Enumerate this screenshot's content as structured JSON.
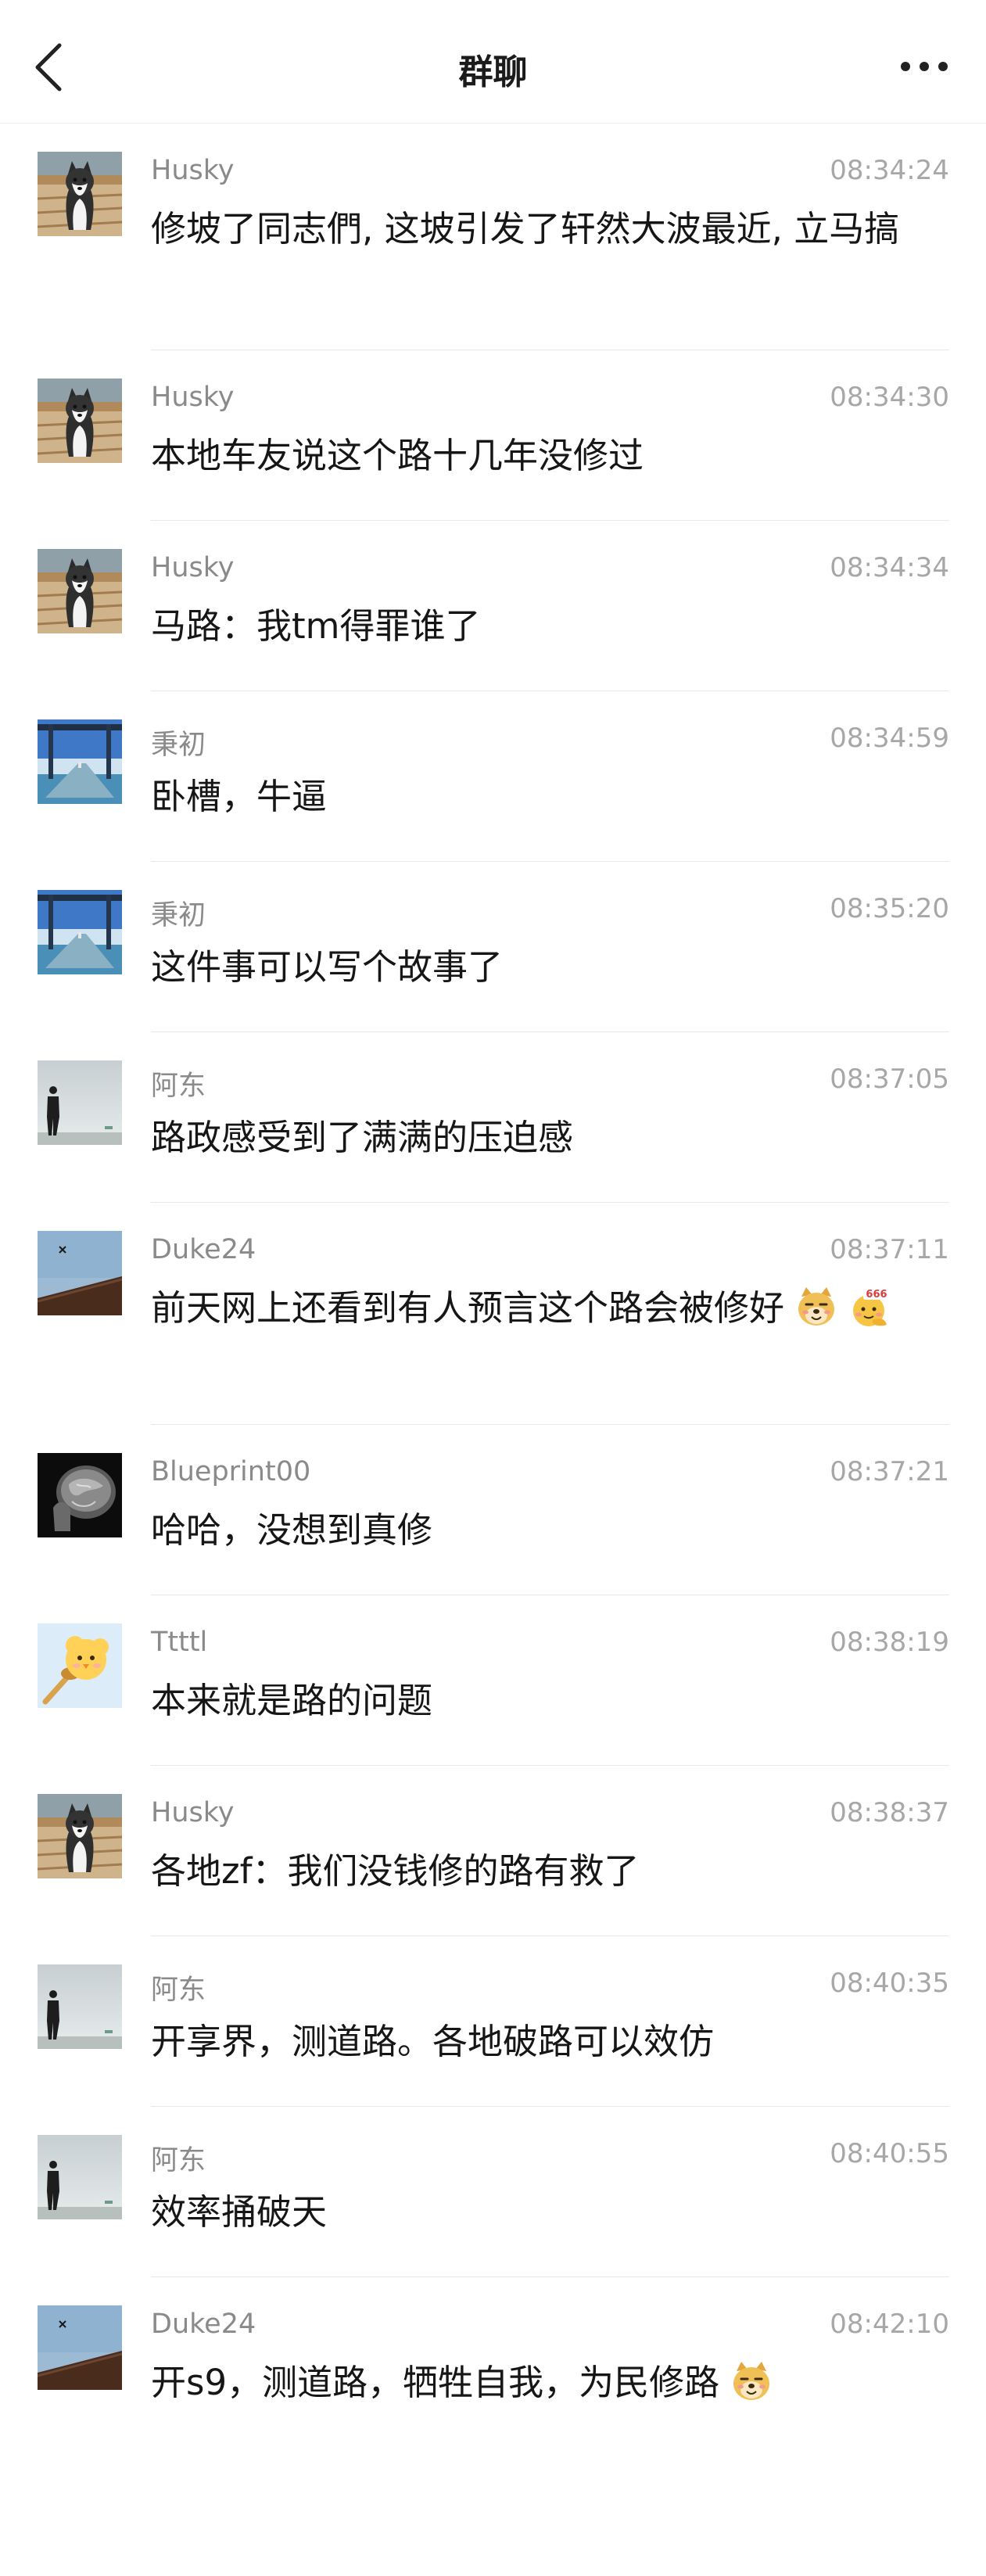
{
  "header": {
    "title": "群聊"
  },
  "messages": [
    {
      "name": "Husky",
      "time": "08:34:24",
      "text": "修坡了同志們, 这坡引发了轩然大波最近, 立马搞",
      "avatar": "husky"
    },
    {
      "name": "Husky",
      "time": "08:34:30",
      "text": "本地车友说这个路十几年没修过",
      "avatar": "husky"
    },
    {
      "name": "Husky",
      "time": "08:34:34",
      "text": "马路：我tm得罪谁了",
      "avatar": "husky"
    },
    {
      "name": "秉初",
      "time": "08:34:59",
      "text": "卧槽，牛逼",
      "avatar": "bridge"
    },
    {
      "name": "秉初",
      "time": "08:35:20",
      "text": "这件事可以写个故事了",
      "avatar": "bridge"
    },
    {
      "name": "阿东",
      "time": "08:37:05",
      "text": "路政感受到了满满的压迫感",
      "avatar": "man"
    },
    {
      "name": "Duke24",
      "time": "08:37:11",
      "text": "前天网上还看到有人预言这个路会被修好",
      "avatar": "roof",
      "emojis": [
        "doge",
        "666"
      ]
    },
    {
      "name": "Blueprint00",
      "time": "08:37:21",
      "text": "哈哈，没想到真修",
      "avatar": "scan"
    },
    {
      "name": "Ttttl",
      "time": "08:38:19",
      "text": "本来就是路的问题",
      "avatar": "chick"
    },
    {
      "name": "Husky",
      "time": "08:38:37",
      "text": "各地zf：我们没钱修的路有救了",
      "avatar": "husky"
    },
    {
      "name": "阿东",
      "time": "08:40:35",
      "text": "开享界，测道路。各地破路可以效仿",
      "avatar": "man"
    },
    {
      "name": "阿东",
      "time": "08:40:55",
      "text": "效率捅破天",
      "avatar": "man"
    },
    {
      "name": "Duke24",
      "time": "08:42:10",
      "text": "开s9，测道路，牺牲自我，为民修路",
      "avatar": "roof",
      "emojis": [
        "doge"
      ]
    }
  ]
}
